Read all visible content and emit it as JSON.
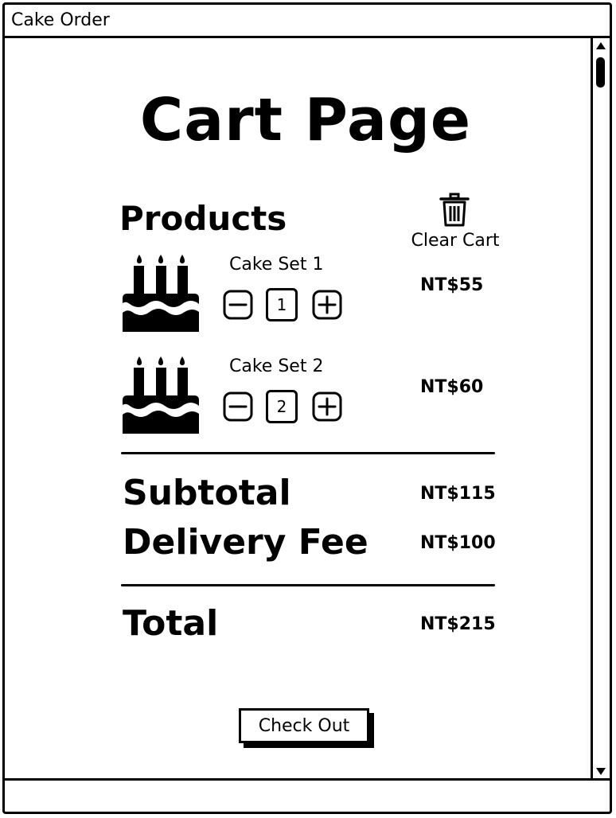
{
  "window": {
    "title": "Cake Order"
  },
  "page": {
    "title": "Cart Page"
  },
  "cart": {
    "products_heading": "Products",
    "clear_cart_label": "Clear Cart",
    "items": [
      {
        "name": "Cake Set 1",
        "quantity": "1",
        "price": "NT$55"
      },
      {
        "name": "Cake Set 2",
        "quantity": "2",
        "price": "NT$60"
      }
    ]
  },
  "summary": {
    "subtotal_label": "Subtotal",
    "subtotal_value": "NT$115",
    "delivery_label": "Delivery Fee",
    "delivery_value": "NT$100",
    "total_label": "Total",
    "total_value": "NT$215"
  },
  "actions": {
    "checkout_label": "Check Out"
  },
  "icons": {
    "product_image": "cake-icon",
    "clear_cart": "trash-icon",
    "decrease": "minus-icon",
    "increase": "plus-icon"
  }
}
